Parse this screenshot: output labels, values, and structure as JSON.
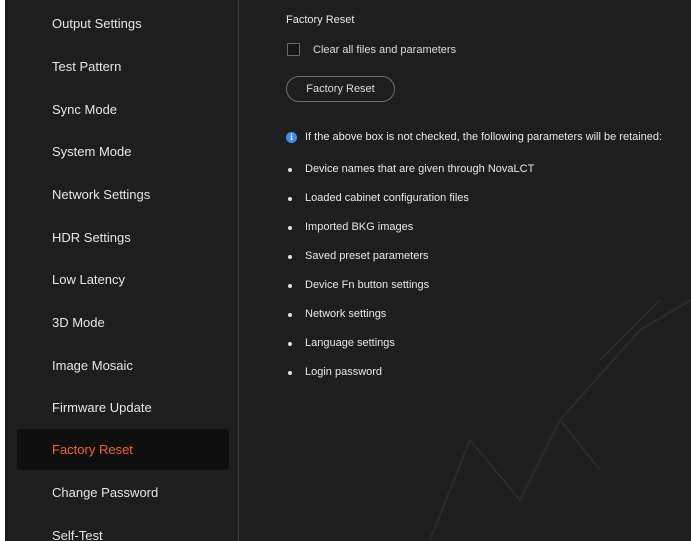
{
  "sidebar": {
    "items": [
      {
        "label": "Output Settings"
      },
      {
        "label": "Test Pattern"
      },
      {
        "label": "Sync Mode"
      },
      {
        "label": "System Mode"
      },
      {
        "label": "Network Settings"
      },
      {
        "label": "HDR Settings"
      },
      {
        "label": "Low Latency"
      },
      {
        "label": "3D Mode"
      },
      {
        "label": "Image Mosaic"
      },
      {
        "label": "Firmware Update"
      },
      {
        "label": "Factory Reset"
      },
      {
        "label": "Change Password"
      },
      {
        "label": "Self-Test"
      }
    ],
    "active_index": 10
  },
  "main": {
    "section_title": "Factory Reset",
    "checkbox": {
      "label": "Clear all files and parameters",
      "checked": false
    },
    "button_label": "Factory Reset",
    "info_text": "If the above box is not checked, the following parameters will be retained:",
    "retained_items": [
      "Device names that are given through NovaLCT",
      "Loaded cabinet configuration files",
      "Imported BKG images",
      "Saved preset parameters",
      "Device Fn button settings",
      "Network settings",
      "Language settings",
      "Login password"
    ]
  },
  "colors": {
    "background": "#1e1e1e",
    "accent": "#f0661a",
    "info": "#3b8ff0"
  },
  "icons": {
    "info": "info-icon"
  }
}
